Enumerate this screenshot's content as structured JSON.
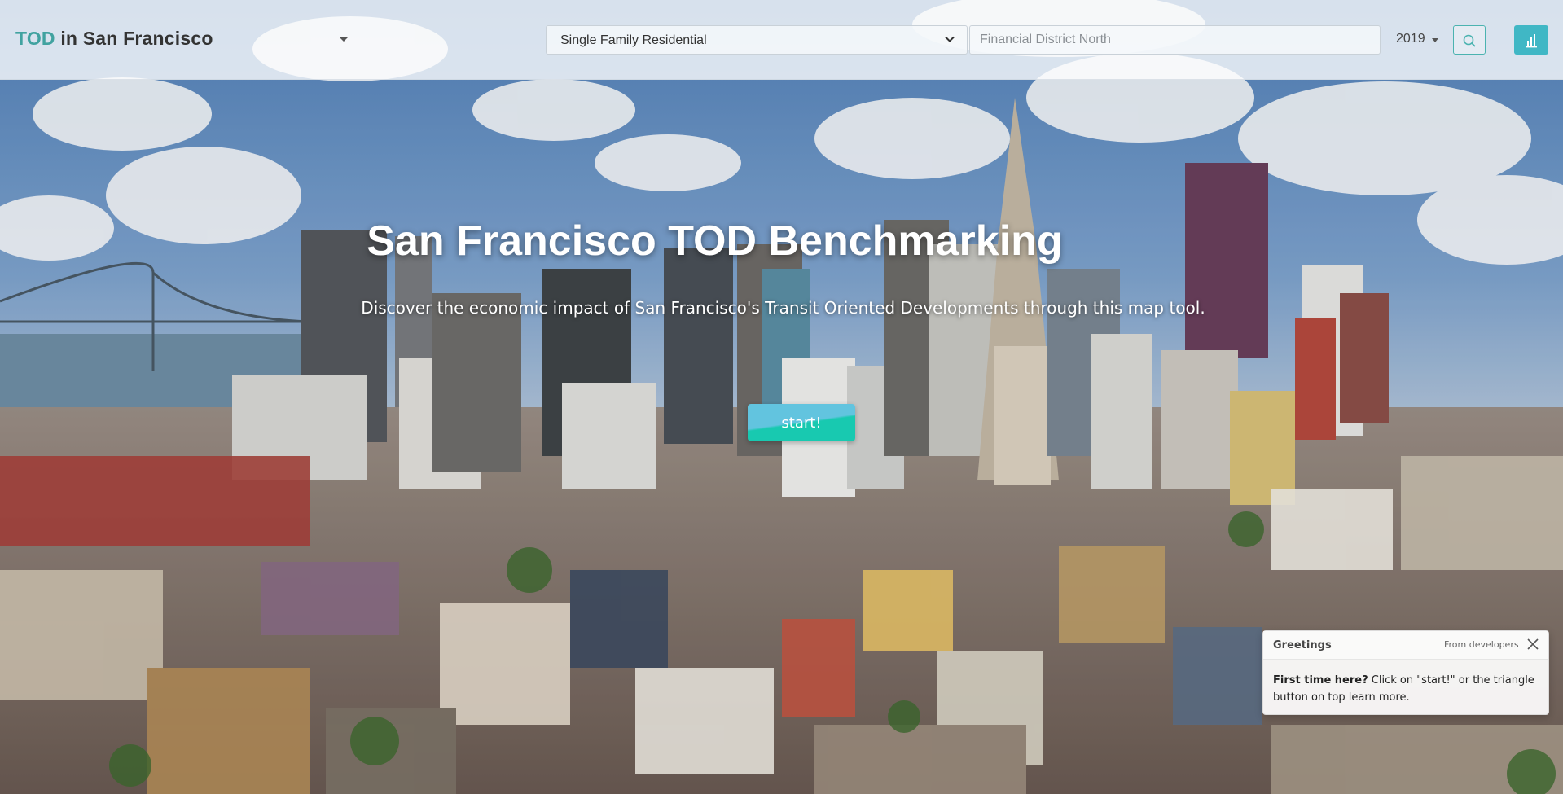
{
  "navbar": {
    "brand_accent": "TOD",
    "brand_rest": "in San Francisco",
    "property_type": "Single Family Residential",
    "search_placeholder": "Financial District North",
    "year": "2019",
    "icons": [
      "caret-down-icon",
      "chevron-down-icon",
      "search-icon",
      "bar-chart-icon"
    ]
  },
  "hero": {
    "title": "San Francisco TOD Benchmarking",
    "subtitle": "Discover the economic impact of San Francisco's Transit Oriented Developments through this map tool.",
    "start_label": "start!"
  },
  "toast": {
    "title": "Greetings",
    "meta": "From developers",
    "body_bold": "First time here?",
    "body_text": " Click on \"start!\" or the triangle button on top learn more."
  },
  "colors": {
    "accent_teal": "#41a2a0",
    "chart_button": "#40b7c5",
    "start_top": "#62c4df",
    "start_bottom": "#18c9b0"
  }
}
